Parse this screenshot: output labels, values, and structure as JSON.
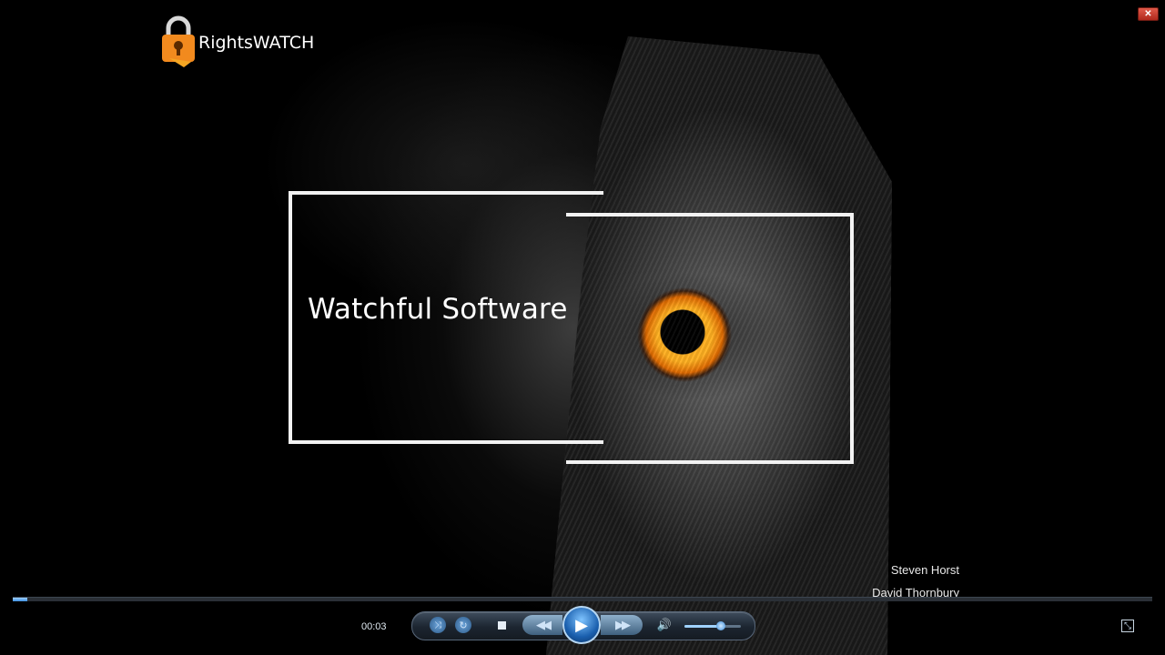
{
  "video": {
    "title": "Watchful Software",
    "logo_text": "RightsWATCH",
    "credits": [
      "Steven Horst",
      "David Thornbury"
    ]
  },
  "player": {
    "current_time": "00:03",
    "progress": 0.013,
    "volume": 0.65,
    "icons": {
      "close": "close-icon",
      "shuffle": "shuffle-icon",
      "repeat": "repeat-icon",
      "stop": "stop-icon",
      "previous": "rewind-icon",
      "play": "play-icon",
      "next": "fast-forward-icon",
      "volume": "speaker-icon",
      "fullscreen": "fullscreen-icon"
    }
  },
  "colors": {
    "lock_orange": "#f28a1e",
    "eye_orange": "#ffb020",
    "player_blue": "#1a5fae"
  }
}
